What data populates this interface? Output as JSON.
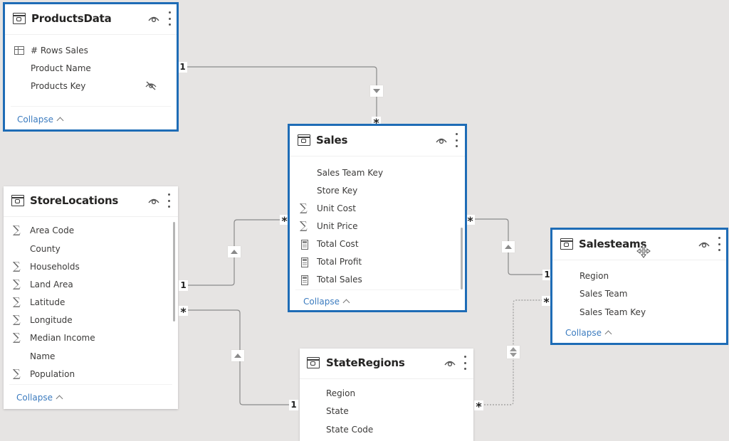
{
  "tables": {
    "productsdata": {
      "title": "ProductsData",
      "fields": [
        {
          "label": "# Rows Sales",
          "icon": "measure-table-icon"
        },
        {
          "label": "Product Name",
          "icon": ""
        },
        {
          "label": "Products Key",
          "icon": "",
          "hidden": true
        }
      ],
      "collapse_label": "Collapse",
      "selected": true
    },
    "sales": {
      "title": "Sales",
      "fields": [
        {
          "label": "Sales Team Key",
          "icon": ""
        },
        {
          "label": "Store Key",
          "icon": ""
        },
        {
          "label": "Unit Cost",
          "icon": "sigma-icon"
        },
        {
          "label": "Unit Price",
          "icon": "sigma-icon"
        },
        {
          "label": "Total Cost",
          "icon": "calculator-icon"
        },
        {
          "label": "Total Profit",
          "icon": "calculator-icon"
        },
        {
          "label": "Total Sales",
          "icon": "calculator-icon"
        }
      ],
      "collapse_label": "Collapse",
      "selected": true
    },
    "storelocations": {
      "title": "StoreLocations",
      "fields": [
        {
          "label": "Area Code",
          "icon": "sigma-icon"
        },
        {
          "label": "County",
          "icon": ""
        },
        {
          "label": "Households",
          "icon": "sigma-icon"
        },
        {
          "label": "Land Area",
          "icon": "sigma-icon"
        },
        {
          "label": "Latitude",
          "icon": "sigma-icon"
        },
        {
          "label": "Longitude",
          "icon": "sigma-icon"
        },
        {
          "label": "Median Income",
          "icon": "sigma-icon"
        },
        {
          "label": "Name",
          "icon": ""
        },
        {
          "label": "Population",
          "icon": "sigma-icon"
        }
      ],
      "collapse_label": "Collapse",
      "selected": false
    },
    "salesteams": {
      "title": "Salesteams",
      "fields": [
        {
          "label": "Region",
          "icon": ""
        },
        {
          "label": "Sales Team",
          "icon": ""
        },
        {
          "label": "Sales Team Key",
          "icon": ""
        }
      ],
      "collapse_label": "Collapse",
      "selected": true
    },
    "stateregions": {
      "title": "StateRegions",
      "fields": [
        {
          "label": "Region",
          "icon": ""
        },
        {
          "label": "State",
          "icon": ""
        },
        {
          "label": "State Code",
          "icon": ""
        }
      ],
      "selected": false
    }
  },
  "relationships": [
    {
      "from": "ProductsData",
      "to": "Sales",
      "from_cardinality": "1",
      "to_cardinality": "*",
      "direction": "single",
      "active": true
    },
    {
      "from": "StoreLocations",
      "to": "Sales",
      "from_cardinality": "1",
      "to_cardinality": "*",
      "direction": "single",
      "active": true
    },
    {
      "from": "Salesteams",
      "to": "Sales",
      "from_cardinality": "1",
      "to_cardinality": "*",
      "direction": "single",
      "active": true
    },
    {
      "from": "StateRegions",
      "to": "StoreLocations",
      "from_cardinality": "1",
      "to_cardinality": "*",
      "direction": "single",
      "active": true
    },
    {
      "from": "StateRegions",
      "to": "Salesteams",
      "from_cardinality": "*",
      "to_cardinality": "*",
      "direction": "both",
      "active": false
    }
  ],
  "markers": {
    "one": "1",
    "many": "*"
  },
  "colors": {
    "canvas": "#e6e4e3",
    "selection": "#1e6cb6",
    "link": "#3b7bbf",
    "line": "#8a8a8a"
  }
}
